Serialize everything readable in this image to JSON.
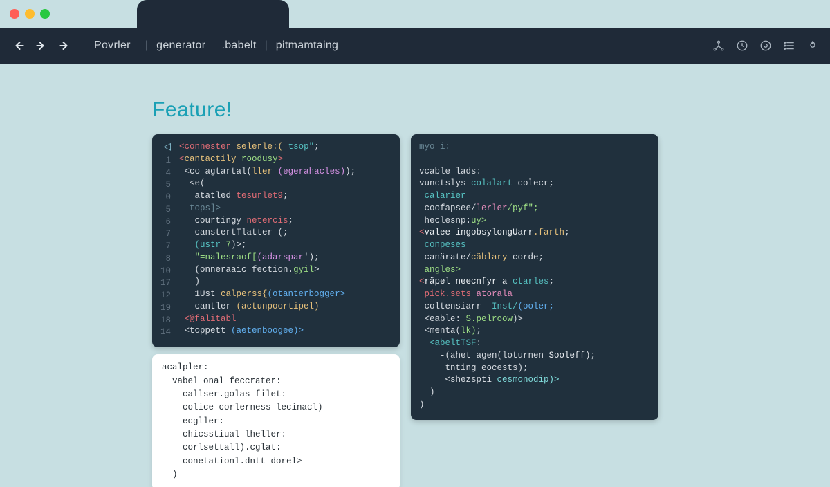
{
  "breadcrumb": {
    "items": [
      "Povrler_",
      "generator __.babelt",
      "pitmamtaing"
    ]
  },
  "page": {
    "title": "Feature!"
  },
  "left_editor": {
    "gutter": [
      "◁",
      "1",
      "4",
      "5",
      "0",
      "5",
      "6",
      "7",
      "7",
      "8",
      "10",
      "17",
      "12",
      "19",
      "18",
      "14"
    ],
    "lines": [
      {
        "segments": [
          {
            "t": "<",
            "c": "tk-tag"
          },
          {
            "t": "connester",
            "c": "tk-tag"
          },
          {
            "t": " selerle:(",
            "c": "tk-attr"
          },
          {
            "t": " tsop\"",
            "c": "tk-teal"
          },
          {
            "t": ";",
            "c": "tk-plain"
          }
        ]
      },
      {
        "segments": [
          {
            "t": "<",
            "c": "tk-tag"
          },
          {
            "t": "cantactily",
            "c": "tk-attr"
          },
          {
            "t": " roodusy",
            "c": "tk-str"
          },
          {
            "t": ">",
            "c": "tk-tag"
          }
        ]
      },
      {
        "segments": [
          {
            "t": " <",
            "c": "tk-plain"
          },
          {
            "t": "co agtartal(",
            "c": "tk-plain"
          },
          {
            "t": "ller ",
            "c": "tk-attr"
          },
          {
            "t": "(egerahacles)",
            "c": "tk-key"
          },
          {
            "t": ");",
            "c": "tk-plain"
          }
        ]
      },
      {
        "segments": [
          {
            "t": "  <e(",
            "c": "tk-plain"
          }
        ]
      },
      {
        "segments": [
          {
            "t": "   atatled",
            "c": "tk-plain"
          },
          {
            "t": " tesurlet9",
            "c": "tk-tag"
          },
          {
            "t": ";",
            "c": "tk-plain"
          }
        ]
      },
      {
        "segments": [
          {
            "t": "  tops]>",
            "c": "tk-cmt"
          }
        ]
      },
      {
        "segments": [
          {
            "t": "   courtingy",
            "c": "tk-plain"
          },
          {
            "t": " netercis",
            "c": "tk-tag"
          },
          {
            "t": ";",
            "c": "tk-plain"
          }
        ]
      },
      {
        "segments": [
          {
            "t": "   canstertTlatter",
            "c": "tk-plain"
          },
          {
            "t": " (;",
            "c": "tk-plain"
          }
        ]
      },
      {
        "segments": [
          {
            "t": "   (ustr",
            "c": "tk-teal"
          },
          {
            "t": " 7",
            "c": "tk-str"
          },
          {
            "t": ")>;",
            "c": "tk-plain"
          }
        ]
      },
      {
        "segments": [
          {
            "t": "   \"=nalesraof[",
            "c": "tk-str"
          },
          {
            "t": "(adarspar",
            "c": "tk-key"
          },
          {
            "t": "');",
            "c": "tk-plain"
          }
        ]
      },
      {
        "segments": [
          {
            "t": "   (onneraaic",
            "c": "tk-plain"
          },
          {
            "t": " fection.",
            "c": "tk-plain"
          },
          {
            "t": "gyil",
            "c": "tk-str"
          },
          {
            "t": ">",
            "c": "tk-plain"
          }
        ]
      },
      {
        "segments": [
          {
            "t": "   )",
            "c": "tk-plain"
          }
        ]
      },
      {
        "segments": [
          {
            "t": "   1Ust",
            "c": "tk-plain"
          },
          {
            "t": " calperss{",
            "c": "tk-attr"
          },
          {
            "t": "(otanterbogger>",
            "c": "tk-fn"
          }
        ]
      },
      {
        "segments": [
          {
            "t": "   cantler",
            "c": "tk-plain"
          },
          {
            "t": " (actunpoortipel)",
            "c": "tk-attr"
          }
        ]
      },
      {
        "segments": [
          {
            "t": " <@falitabl ",
            "c": "tk-tag"
          }
        ]
      },
      {
        "segments": [
          {
            "t": " <toppett",
            "c": "tk-plain"
          },
          {
            "t": " (aetenboogee)>",
            "c": "tk-fn"
          }
        ]
      }
    ]
  },
  "left_light": {
    "lines": [
      "acalpler:",
      "  vabel onal feccrater:",
      "    callser.golas filet:",
      "    colice corlerness lecinacl)",
      "    ecgller:",
      "    chicsstiual lheller:",
      "    corlsettall).cglat:",
      "    conetationl.dntt dorel>",
      "  )"
    ]
  },
  "right_editor": {
    "lines": [
      {
        "segments": [
          {
            "t": "myo i:",
            "c": "tk-cmt"
          }
        ]
      },
      {
        "segments": [
          {
            "t": "",
            "c": "tk-plain"
          }
        ]
      },
      {
        "segments": [
          {
            "t": "vcable lads:",
            "c": "tk-plain"
          }
        ]
      },
      {
        "segments": [
          {
            "t": "vunctslys",
            "c": "tk-plain"
          },
          {
            "t": " colalart",
            "c": "tk-teal"
          },
          {
            "t": " colecr;",
            "c": "tk-plain"
          }
        ]
      },
      {
        "segments": [
          {
            "t": " calarier",
            "c": "tk-teal"
          }
        ]
      },
      {
        "segments": [
          {
            "t": " coofapsee/",
            "c": "tk-plain"
          },
          {
            "t": "lerler",
            "c": "tk-mag"
          },
          {
            "t": "/pyf\";",
            "c": "tk-str"
          }
        ]
      },
      {
        "segments": [
          {
            "t": " heclesnp:",
            "c": "tk-plain"
          },
          {
            "t": "uy>",
            "c": "tk-str"
          }
        ]
      },
      {
        "segments": [
          {
            "t": "<",
            "c": "tk-tag"
          },
          {
            "t": "valee ingobsylongUarr",
            "c": "tk-white"
          },
          {
            "t": ".farth",
            "c": "tk-attr"
          },
          {
            "t": ";",
            "c": "tk-plain"
          }
        ]
      },
      {
        "segments": [
          {
            "t": " conpeses",
            "c": "tk-teal"
          }
        ]
      },
      {
        "segments": [
          {
            "t": " canärate/",
            "c": "tk-plain"
          },
          {
            "t": "cäblary",
            "c": "tk-attr"
          },
          {
            "t": " corde;",
            "c": "tk-plain"
          }
        ]
      },
      {
        "segments": [
          {
            "t": " angles>",
            "c": "tk-str"
          }
        ]
      },
      {
        "segments": [
          {
            "t": "<",
            "c": "tk-tag"
          },
          {
            "t": "räpel neecnfyr a",
            "c": "tk-white"
          },
          {
            "t": " ctarles",
            "c": "tk-teal"
          },
          {
            "t": ";",
            "c": "tk-plain"
          }
        ]
      },
      {
        "segments": [
          {
            "t": " pick.sets",
            "c": "tk-tag"
          },
          {
            "t": " atorala",
            "c": "tk-mag"
          }
        ]
      },
      {
        "segments": [
          {
            "t": " coltensiarr",
            "c": "tk-plain"
          },
          {
            "t": "  Inst/",
            "c": "tk-teal"
          },
          {
            "t": "(ooler;",
            "c": "tk-fn"
          }
        ]
      },
      {
        "segments": [
          {
            "t": " <eable:",
            "c": "tk-plain"
          },
          {
            "t": " S.pelroow",
            "c": "tk-str"
          },
          {
            "t": ")>",
            "c": "tk-plain"
          }
        ]
      },
      {
        "segments": [
          {
            "t": " <menta(",
            "c": "tk-plain"
          },
          {
            "t": "lk)",
            "c": "tk-str"
          },
          {
            "t": ";",
            "c": "tk-plain"
          }
        ]
      },
      {
        "segments": [
          {
            "t": "  <abeltTSF",
            "c": "tk-teal"
          },
          {
            "t": ":",
            "c": "tk-plain"
          }
        ]
      },
      {
        "segments": [
          {
            "t": "    -(ahet agen(loturnen",
            "c": "tk-plain"
          },
          {
            "t": " Sooleff",
            "c": "tk-white"
          },
          {
            "t": ");",
            "c": "tk-plain"
          }
        ]
      },
      {
        "segments": [
          {
            "t": "     tnting eocests);",
            "c": "tk-plain"
          }
        ]
      },
      {
        "segments": [
          {
            "t": "     <shezspti",
            "c": "tk-plain"
          },
          {
            "t": " cesmonodip)>",
            "c": "tk-aqua"
          }
        ]
      },
      {
        "segments": [
          {
            "t": "  )",
            "c": "tk-plain"
          }
        ]
      },
      {
        "segments": [
          {
            "t": ")",
            "c": "tk-plain"
          }
        ]
      }
    ]
  }
}
